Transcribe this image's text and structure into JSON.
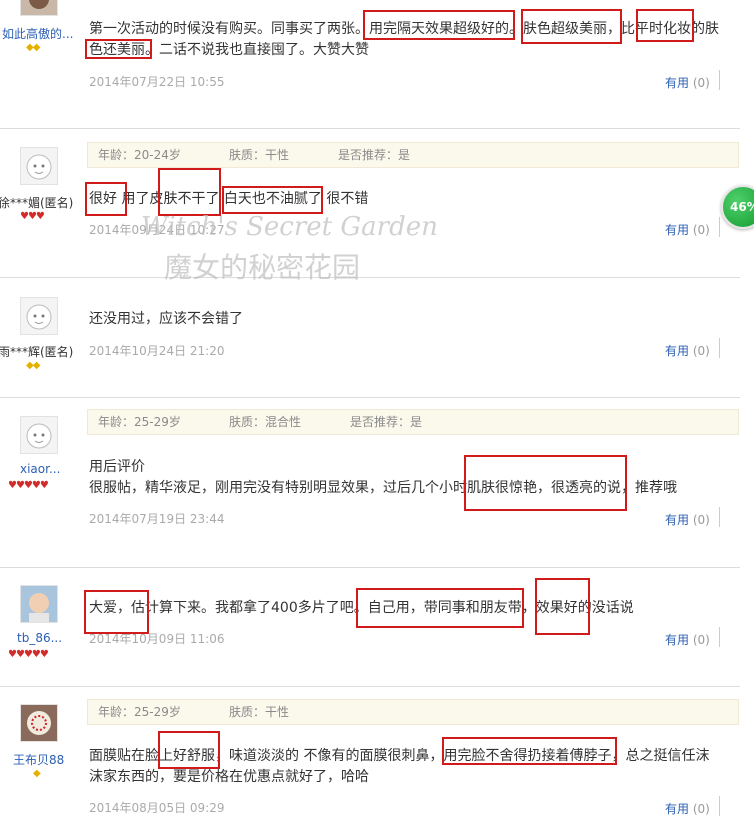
{
  "reviews": [
    {
      "user": {
        "name": "如此高傲的...",
        "icon": "photo-avatar",
        "badge": "◆◆"
      },
      "text": [
        "第一次活动的时候没有购买。同事买了两张。用完隔天效果超级好的。肤色超级美丽，比平时化妆的肤",
        "色还美丽。二话不说我也直接囤了。大赞大赞"
      ],
      "date": "2014年07月22日 10:55",
      "useful": {
        "label": "有用",
        "count": "(0)"
      }
    },
    {
      "user": {
        "name": "徐***媚(匿名)",
        "icon": "default-avatar",
        "badge": "♥♥♥"
      },
      "meta": {
        "age": "年龄：20-24岁",
        "skin": "肤质：干性",
        "recommend": "是否推荐：是"
      },
      "text": [
        "很好 用了皮肤不干了 白天也不油腻了 很不错"
      ],
      "date": "2014年09月24日 10:27",
      "useful": {
        "label": "有用",
        "count": "(0)"
      }
    },
    {
      "user": {
        "name": "雨***辉(匿名)",
        "icon": "default-avatar",
        "badge": "◆◆"
      },
      "text": [
        "还没用过，应该不会错了"
      ],
      "date": "2014年10月24日 21:20",
      "useful": {
        "label": "有用",
        "count": "(0)"
      }
    },
    {
      "user": {
        "name": "xiaor...",
        "icon": "default-avatar",
        "badge": "♥♥♥♥♥"
      },
      "meta": {
        "age": "年龄：25-29岁",
        "skin": "肤质：混合性",
        "recommend": "是否推荐：是"
      },
      "text": [
        "用后评价",
        "很服帖，精华液足，刚用完没有特别明显效果，过后几个小时肌肤很惊艳，很透亮的说，推荐哦"
      ],
      "date": "2014年07月19日 23:44",
      "useful": {
        "label": "有用",
        "count": "(0)"
      }
    },
    {
      "user": {
        "name": "tb_86...",
        "icon": "photo-avatar",
        "badge": "♥♥♥♥♥"
      },
      "text": [
        "大爱，估计算下来。我都拿了400多片了吧。自己用，带同事和朋友带，效果好的没话说"
      ],
      "date": "2014年10月09日 11:06",
      "useful": {
        "label": "有用",
        "count": "(0)"
      }
    },
    {
      "user": {
        "name": "王布贝88",
        "icon": "photo-avatar",
        "badge": "◆"
      },
      "meta": {
        "age": "年龄：25-29岁",
        "skin": "肤质：干性"
      },
      "text": [
        "面膜贴在脸上好舒服，味道淡淡的 不像有的面膜很刺鼻，用完脸不舍得扔接着傅脖子，总之挺信任沫",
        "沫家东西的，要是价格在优惠点就好了，哈哈"
      ],
      "date": "2014年08月05日 09:29",
      "useful": {
        "label": "有用",
        "count": "(0)"
      }
    }
  ],
  "watermark": {
    "line1": "Witch's Secret Garden",
    "line2": "魔女的秘密花园"
  },
  "progress": {
    "label": "46%",
    "value": 46
  },
  "colors": {
    "highlight": "#d11a1a",
    "link": "#2b5fb4",
    "meta_bg": "#fbf8ec"
  }
}
